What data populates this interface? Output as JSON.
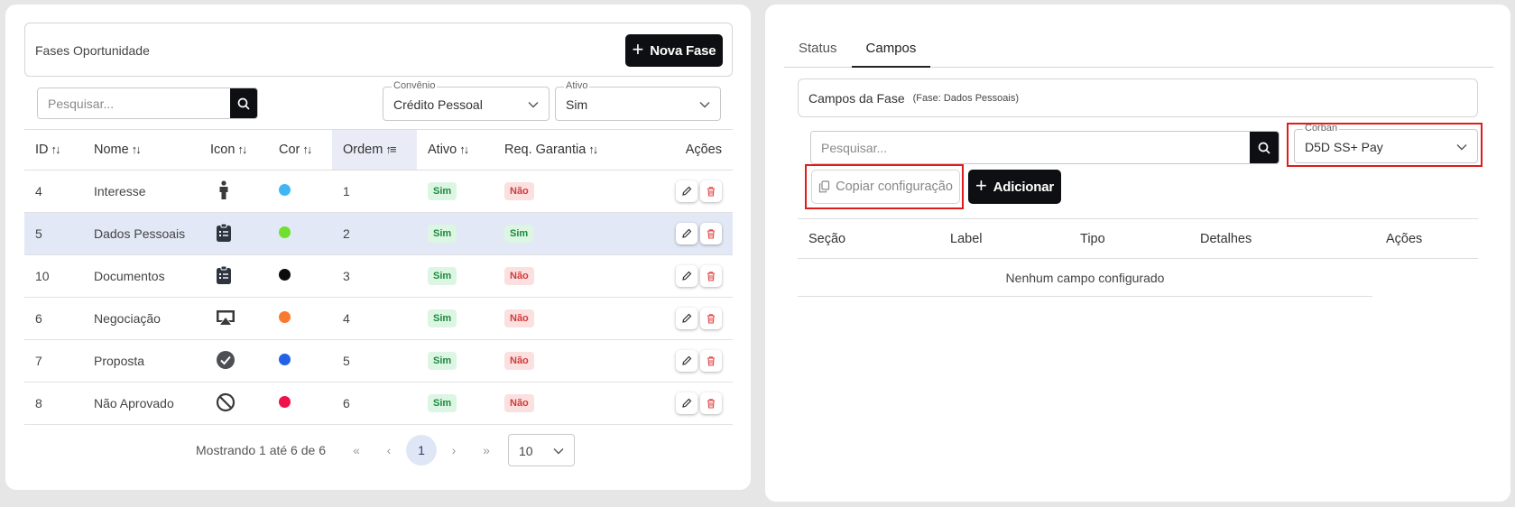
{
  "left": {
    "header": {
      "title": "Fases Oportunidade",
      "new_button": "Nova Fase"
    },
    "search": {
      "placeholder": "Pesquisar..."
    },
    "filters": {
      "convenio": {
        "label": "Convênio",
        "value": "Crédito Pessoal"
      },
      "ativo": {
        "label": "Ativo",
        "value": "Sim"
      }
    },
    "columns": [
      "ID",
      "Nome",
      "Icon",
      "Cor",
      "Ordem",
      "Ativo",
      "Req. Garantia",
      "Ações"
    ],
    "rows": [
      {
        "id": "4",
        "nome": "Interesse",
        "icon": "person-icon",
        "cor": "#3fb7f5",
        "ordem": "1",
        "ativo": "Sim",
        "garantia": "Não"
      },
      {
        "id": "5",
        "nome": "Dados Pessoais",
        "icon": "clipboard-list-icon",
        "cor": "#6ee02d",
        "ordem": "2",
        "ativo": "Sim",
        "garantia": "Sim"
      },
      {
        "id": "10",
        "nome": "Documentos",
        "icon": "clipboard-list-icon",
        "cor": "#0b0b0b",
        "ordem": "3",
        "ativo": "Sim",
        "garantia": "Não"
      },
      {
        "id": "6",
        "nome": "Negociação",
        "icon": "airplay-icon",
        "cor": "#f97a2c",
        "ordem": "4",
        "ativo": "Sim",
        "garantia": "Não"
      },
      {
        "id": "7",
        "nome": "Proposta",
        "icon": "check-circle-icon",
        "cor": "#2362e6",
        "ordem": "5",
        "ativo": "Sim",
        "garantia": "Não"
      },
      {
        "id": "8",
        "nome": "Não Aprovado",
        "icon": "block-icon",
        "cor": "#f0104a",
        "ordem": "6",
        "ativo": "Sim",
        "garantia": "Não"
      }
    ],
    "pager": {
      "info": "Mostrando 1 até 6 de 6",
      "page": "1",
      "first": "«",
      "prev": "‹",
      "next": "›",
      "last": "»",
      "size": "10"
    }
  },
  "right": {
    "tabs": [
      "Status",
      "Campos"
    ],
    "header": {
      "title": "Campos da Fase",
      "subtitle": "(Fase: Dados Pessoais)"
    },
    "search": {
      "placeholder": "Pesquisar..."
    },
    "corban": {
      "label": "Corban",
      "value": "D5D SS+ Pay"
    },
    "copy_button": "Copiar configuração",
    "add_button": "Adicionar",
    "columns": [
      "Seção",
      "Label",
      "Tipo",
      "Detalhes",
      "Ações"
    ],
    "empty_message": "Nenhum campo configurado"
  },
  "colors": {
    "dark": "#0e0f12",
    "highlight": "#e01b1b",
    "selected_row": "#e2e8f5"
  }
}
